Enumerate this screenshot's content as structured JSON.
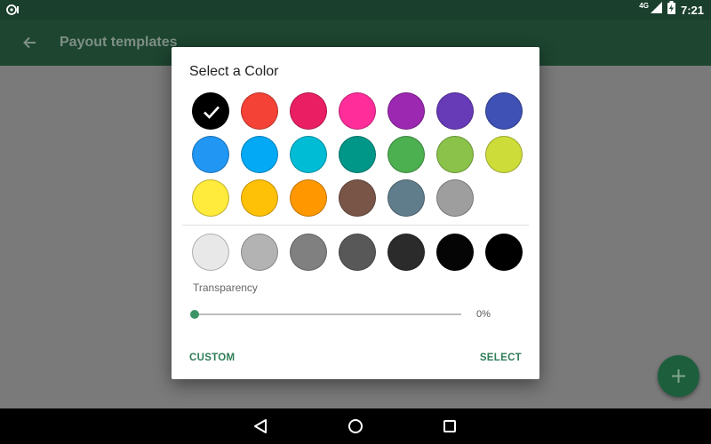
{
  "status_bar": {
    "time": "7:21",
    "network_label": "4G",
    "icons": [
      "notification-icon",
      "signal-icon",
      "battery-charging-icon"
    ]
  },
  "app_bar": {
    "title": "Payout templates",
    "back_icon": "arrow-back-icon"
  },
  "dialog": {
    "title": "Select a Color",
    "selected_color": "#000000",
    "palette": [
      "#000000",
      "#f44336",
      "#e91e63",
      "#ff2d9a",
      "#9c27b0",
      "#673ab7",
      "#3f51b5",
      "#2196f3",
      "#03a9f4",
      "#00bcd4",
      "#009688",
      "#4caf50",
      "#8bc34a",
      "#cddc39",
      "#ffeb3b",
      "#ffc107",
      "#ff9800",
      "#795548",
      "#607d8b",
      "#9e9e9e"
    ],
    "shades": [
      "#e8e8e8",
      "#b3b3b3",
      "#808080",
      "#585858",
      "#2b2b2b",
      "#050505",
      "#000000"
    ],
    "transparency": {
      "label": "Transparency",
      "value_text": "0%",
      "value": 0
    },
    "custom_label": "CUSTOM",
    "select_label": "SELECT"
  },
  "fab": {
    "icon": "add-icon"
  },
  "nav_bar": {
    "icons": [
      "back-triangle-icon",
      "home-circle-icon",
      "recents-square-icon"
    ]
  },
  "colors": {
    "status_bar": "#1a3f2d",
    "app_bar_dimmed": "#1d4530",
    "accent": "#2e7d57",
    "slider_thumb": "#3a9467",
    "fab": "#1d5e3c"
  }
}
